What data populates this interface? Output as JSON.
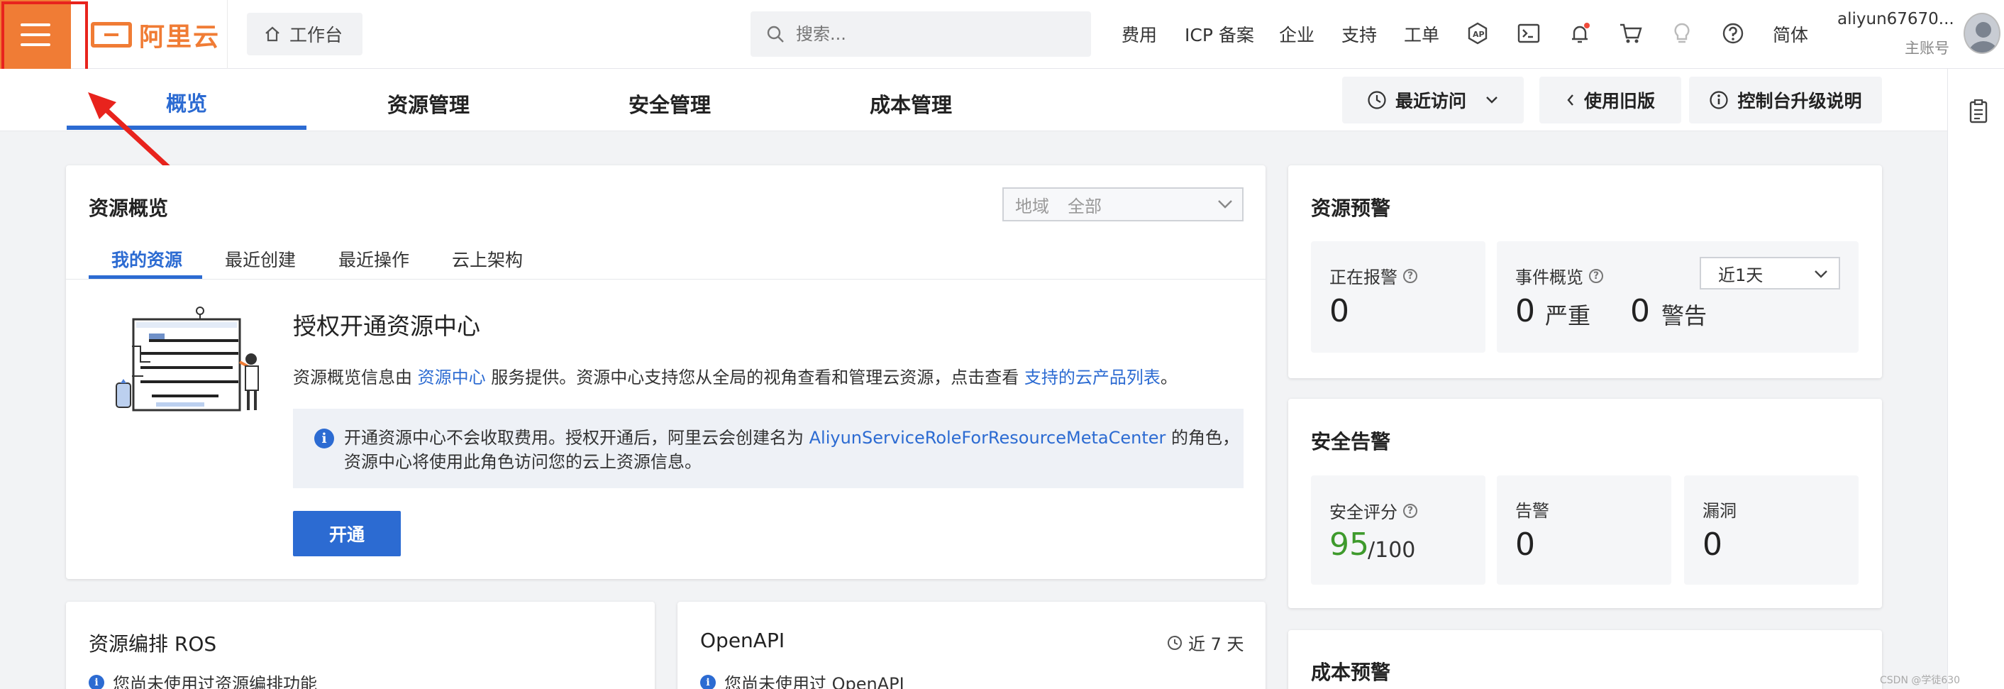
{
  "header": {
    "logo_text": "阿里云",
    "workbench_label": "工作台",
    "search_placeholder": "搜索...",
    "nav": [
      "费用",
      "ICP 备案",
      "企业",
      "支持",
      "工单"
    ],
    "lang_label": "简体",
    "user_name": "aliyun67670...",
    "user_role": "主账号",
    "icon_names": [
      "api-icon",
      "terminal-icon",
      "bell-icon",
      "cart-icon",
      "bulb-icon",
      "help-icon"
    ],
    "accent_color": "#f07c35"
  },
  "main_tabs": [
    {
      "label": "概览",
      "active": true
    },
    {
      "label": "资源管理",
      "active": false
    },
    {
      "label": "安全管理",
      "active": false
    },
    {
      "label": "成本管理",
      "active": false
    }
  ],
  "top_buttons": {
    "recent": "最近访问",
    "old_version": "使用旧版",
    "upgrade_notes": "控制台升级说明"
  },
  "resource_overview": {
    "title": "资源概览",
    "region_label": "地域",
    "region_value": "全部",
    "tabs": [
      {
        "label": "我的资源",
        "active": true
      },
      {
        "label": "最近创建",
        "active": false
      },
      {
        "label": "最近操作",
        "active": false
      },
      {
        "label": "云上架构",
        "active": false
      }
    ],
    "heading": "授权开通资源中心",
    "desc_prefix": "资源概览信息由 ",
    "desc_link1": "资源中心",
    "desc_middle": " 服务提供。资源中心支持您从全局的视角查看和管理云资源，点击查看 ",
    "desc_link2": "支持的云产品列表",
    "desc_suffix": "。",
    "info_prefix": "开通资源中心不会收取费用。授权开通后，阿里云会创建名为 ",
    "info_link": "AliyunServiceRoleForResourceMetaCenter",
    "info_suffix": " 的角色，",
    "info_line2": "资源中心将使用此角色访问您的云上资源信息。",
    "open_button": "开通"
  },
  "resource_alert": {
    "title": "资源预警",
    "alarm_label": "正在报警",
    "alarm_value": "0",
    "event_label": "事件概览",
    "day_select": "近1天",
    "serious_value": "0",
    "serious_label": "严重",
    "warning_value": "0",
    "warning_label": "警告"
  },
  "security_alert": {
    "title": "安全告警",
    "score_label": "安全评分",
    "score_value": "95",
    "score_total": "/100",
    "score_color": "#3e9a2c",
    "alarm_label": "告警",
    "alarm_value": "0",
    "vuln_label": "漏洞",
    "vuln_value": "0"
  },
  "ros_card": {
    "title": "资源编排 ROS",
    "notice": "您尚未使用过资源编排功能"
  },
  "openapi_card": {
    "title": "OpenAPI",
    "range": "近 7 天",
    "notice": "您尚未使用过 OpenAPI"
  },
  "cost_card": {
    "title": "成本预警"
  },
  "watermark": "CSDN @学徒630"
}
